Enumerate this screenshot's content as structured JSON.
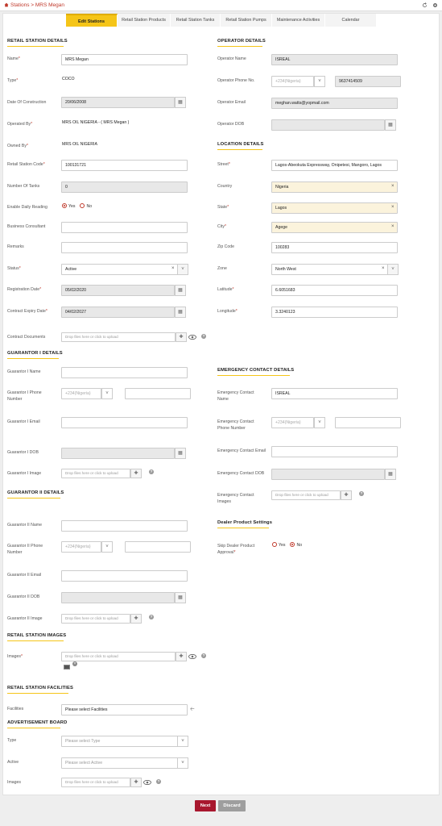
{
  "breadcrumb": {
    "text": "Stations > MRS Megan"
  },
  "tabs": [
    "Edit Stations",
    "Retail Station Products",
    "Retail Station Tanks",
    "Retail Station Pumps",
    "Maintenance Activities",
    "Calendar"
  ],
  "sections": {
    "retail": "RETAIL STATION DETAILS",
    "operator": "OPERATOR DETAILS",
    "location": "LOCATION DETAILS",
    "guarantor1": "GUARANTOR I DETAILS",
    "emergency": "EMERGENCY CONTACT DETAILS",
    "guarantor2": "GUARANTOR II DETAILS",
    "dealer": "Dealer Product Settings",
    "images": "RETAIL STATION IMAGES",
    "facilities": "RETAIL STATION FACILITIES",
    "advert": "ADVERTISEMENT BOARD"
  },
  "labels": {
    "name": "Name",
    "type": "Type",
    "date_construction": "Date Of Construction",
    "operated_by": "Operated By",
    "owned_by": "Owned By",
    "station_code": "Retail Station Code",
    "num_tanks": "Number Of Tanks",
    "daily_reading": "Enable Daily Reading",
    "consultant": "Business Consultant",
    "remarks": "Remarks",
    "status": "Status",
    "reg_date": "Registration Date",
    "expiry": "Contract Expiry Date",
    "docs": "Contract Documents",
    "op_name": "Operator Name",
    "op_phone": "Operator Phone No.",
    "op_email": "Operator Email",
    "op_dob": "Operator DOB",
    "street": "Street",
    "country": "Country",
    "state": "State",
    "city": "City",
    "zip": "Zip Code",
    "zone": "Zone",
    "lat": "Latitude",
    "lon": "Longitude",
    "g1_name": "Guarantor I Name",
    "g1_phone_a": "Guarantor I Phone",
    "g1_phone_b": "Number",
    "g1_email": "Guarantor I Email",
    "g1_dob": "Guarantor I DOB",
    "g1_image": "Guarantor I Image",
    "ec_name_a": "Emergency Contact",
    "ec_name_b": "Name",
    "ec_phone_a": "Emergency Contact",
    "ec_phone_b": "Phone Number",
    "ec_email": "Emergency Contact Email",
    "ec_dob": "Emergency Contact DOB",
    "ec_images_a": "Emergency Contact",
    "ec_images_b": "Images",
    "g2_name": "Guarantor II Name",
    "g2_phone_a": "Guarantor II Phone",
    "g2_phone_b": "Number",
    "g2_email": "Guarantor II Email",
    "g2_dob": "Guarantor II DOB",
    "g2_image": "Guarantor II Image",
    "skip_a": "Skip Dealer Product",
    "skip_b": "Approval",
    "images": "Images",
    "facilities": "Facilities",
    "adv_type": "Type",
    "adv_active": "Active",
    "adv_images": "Images"
  },
  "values": {
    "name": "MRS Megan",
    "type": "COCO",
    "date_construction": "20/06/2008",
    "operated_by": "MRS OIL NIGERIA - ( MRS Megan )",
    "owned_by": "MRS OIL NIGERIA",
    "station_code": "100131721",
    "num_tanks": "0",
    "status": "Active",
    "reg_date": "05/02/2020",
    "expiry": "04/02/2027",
    "op_name": "ISREAL",
    "op_phone_code": "+234(Nigeria)",
    "op_phone": "9637414509",
    "op_email": "meghan.watts@yopmail.com",
    "street": "Lagos-Abeokuta Expressway, Onipetesi, Mangoro, Lagos",
    "country": "Nigeria",
    "state": "Lagos",
    "city": "Agege",
    "zip": "100283",
    "zone": "North West",
    "lat": "6.6051683",
    "lon": "3.3240123",
    "ec_name": "ISREAL",
    "ec_phone_code": "+234(Nigeria)",
    "g1_phone_code": "+234(Nigeria)",
    "g2_phone_code": "+234(Nigeria)"
  },
  "radios": {
    "yes": "Yes",
    "no": "No"
  },
  "placeholders": {
    "upload": "Drop files here or click to upload",
    "facilities": "Please select Facilities",
    "type": "Please select Type",
    "active": "Please select Active"
  },
  "buttons": {
    "next": "Next",
    "discard": "Discard"
  },
  "colors": {
    "accent": "#f5c518",
    "primary": "#a8172e",
    "discard": "#9e9e9e"
  }
}
